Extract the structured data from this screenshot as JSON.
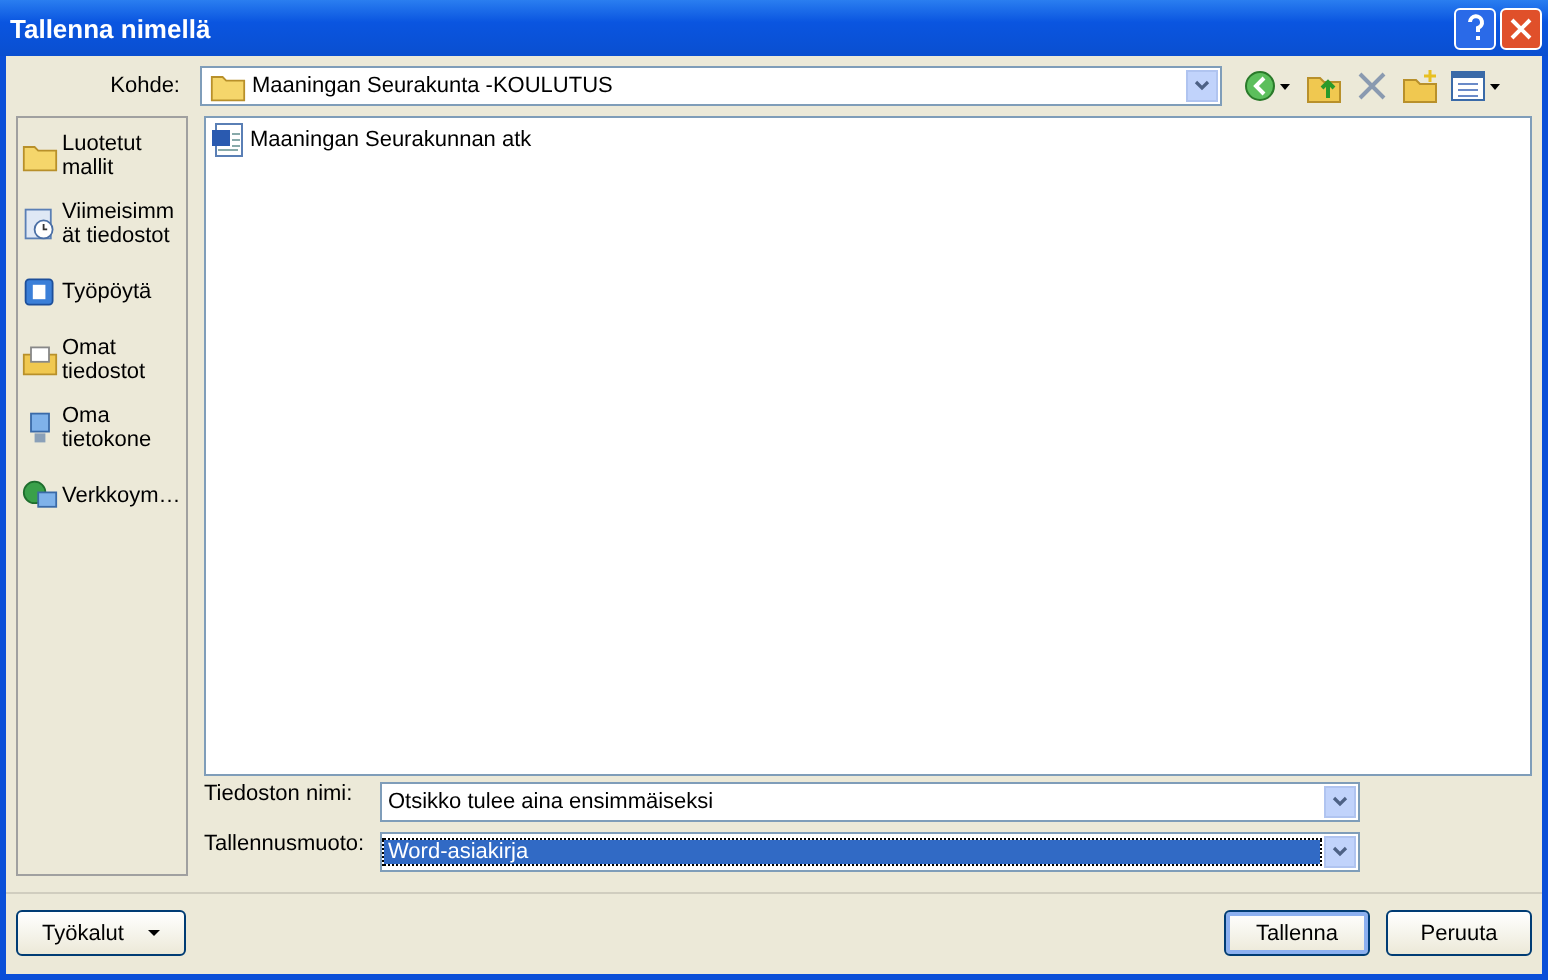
{
  "window": {
    "title": "Tallenna nimellä"
  },
  "location": {
    "label": "Kohde:",
    "value": "Maaningan Seurakunta -KOULUTUS"
  },
  "places": [
    {
      "label": "Luotetut mallit",
      "kind": "folder"
    },
    {
      "label": "Viimeisimmät tiedostot",
      "kind": "recent"
    },
    {
      "label": "Työpöytä",
      "kind": "desktop"
    },
    {
      "label": "Omat tiedostot",
      "kind": "documents"
    },
    {
      "label": "Oma tietokone",
      "kind": "computer"
    },
    {
      "label": "Verkkoym…",
      "kind": "network"
    }
  ],
  "files": [
    {
      "name": "Maaningan Seurakunnan atk"
    }
  ],
  "fields": [
    {
      "label": "Tiedoston nimi:",
      "value": "Otsikko tulee aina ensimmäiseksi",
      "selected": false
    },
    {
      "label": "Tallennusmuoto:",
      "value": "Word-asiakirja",
      "selected": true
    }
  ],
  "tools_button": "Työkalut",
  "buttons": [
    {
      "label": "Tallenna",
      "default": true
    },
    {
      "label": "Peruuta",
      "default": false
    }
  ]
}
